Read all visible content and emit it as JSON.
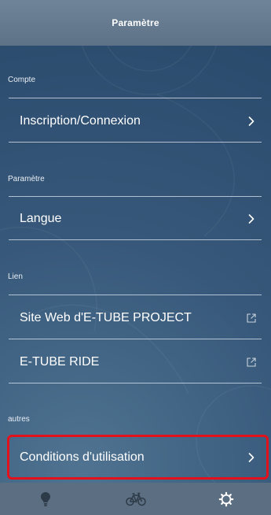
{
  "header": {
    "title": "Paramètre"
  },
  "sections": [
    {
      "label": "Compte",
      "items": [
        {
          "label": "Inscription/Connexion",
          "icon": "chevron-right-icon"
        }
      ]
    },
    {
      "label": "Paramètre",
      "items": [
        {
          "label": "Langue",
          "icon": "chevron-right-icon"
        }
      ]
    },
    {
      "label": "Lien",
      "items": [
        {
          "label": "Site Web d'E-TUBE PROJECT",
          "icon": "external-link-icon"
        },
        {
          "label": "E-TUBE RIDE",
          "icon": "external-link-icon"
        }
      ]
    },
    {
      "label": "autres",
      "items": [
        {
          "label": "Conditions d'utilisation",
          "icon": "chevron-right-icon"
        }
      ]
    }
  ],
  "tabbar": {
    "tabs": [
      {
        "icon": "lightbulb-icon",
        "active": false
      },
      {
        "icon": "bicycle-icon",
        "active": false
      },
      {
        "icon": "gear-icon",
        "active": true
      }
    ]
  },
  "colors": {
    "highlight": "#e3111b",
    "header_bg": "#65798e",
    "tabbar_bg": "#5c6e81",
    "active_icon": "#ffffff",
    "inactive_icon": "#2d3a48"
  }
}
